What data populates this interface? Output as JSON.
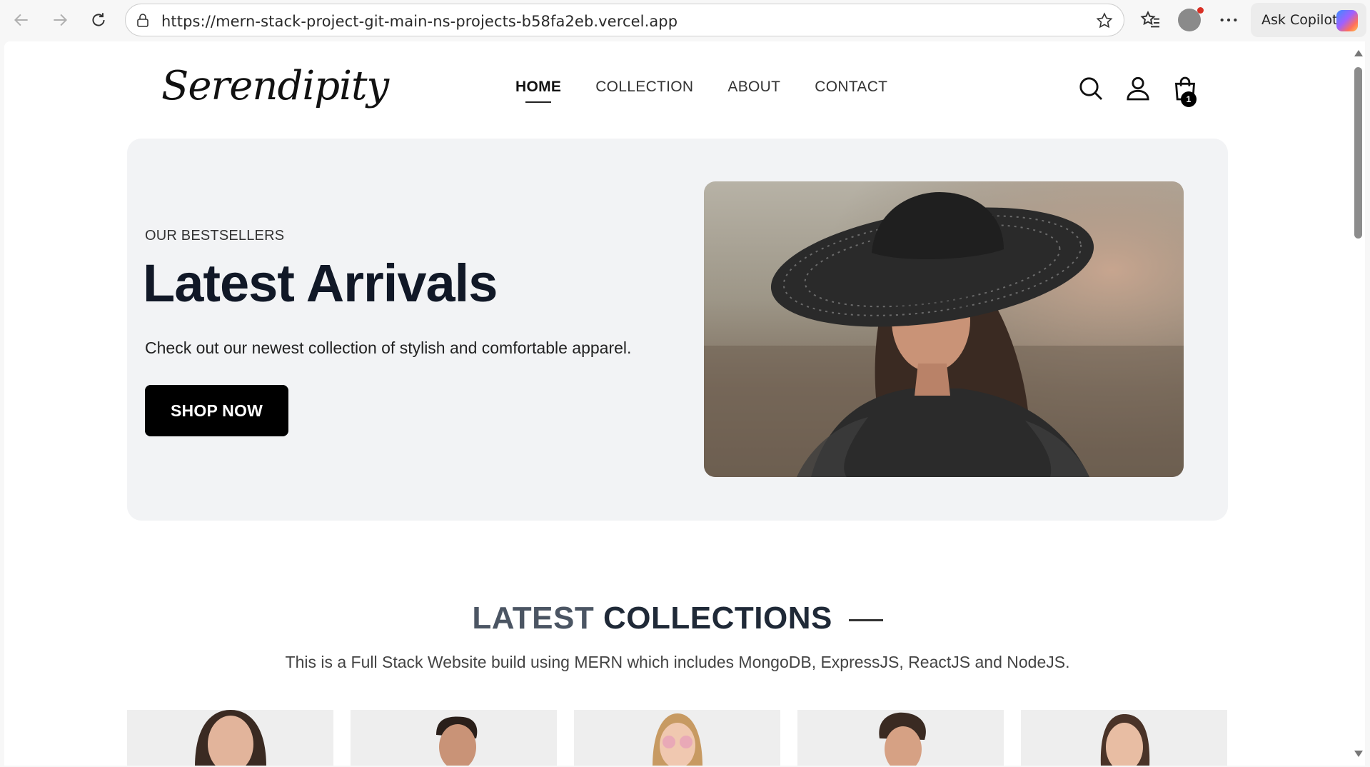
{
  "browser": {
    "url": "https://mern-stack-project-git-main-ns-projects-b58fa2eb.vercel.app",
    "copilot_label": "Ask Copilot",
    "icons": [
      "back-icon",
      "forward-icon",
      "reload-icon",
      "lock-icon",
      "star-icon",
      "favorites-icon",
      "profile-icon",
      "more-icon",
      "copilot-icon"
    ]
  },
  "site": {
    "logo": "Serendipity",
    "nav": {
      "home": "HOME",
      "collection": "COLLECTION",
      "about": "ABOUT",
      "contact": "CONTACT"
    },
    "cart_count": "1"
  },
  "hero": {
    "eyebrow": "OUR BESTSELLERS",
    "title": "Latest Arrivals",
    "text": "Check out our newest collection of stylish and comfortable apparel.",
    "button": "SHOP NOW"
  },
  "collections": {
    "title_light": "LATEST",
    "title_bold": "COLLECTIONS",
    "subtitle": "This is a Full Stack Website build using MERN which includes MongoDB, ExpressJS, ReactJS and NodeJS.",
    "product_count": 5
  },
  "colors": {
    "hero_bg": "#f2f3f5",
    "button_bg": "#000000",
    "heading": "#111827"
  }
}
